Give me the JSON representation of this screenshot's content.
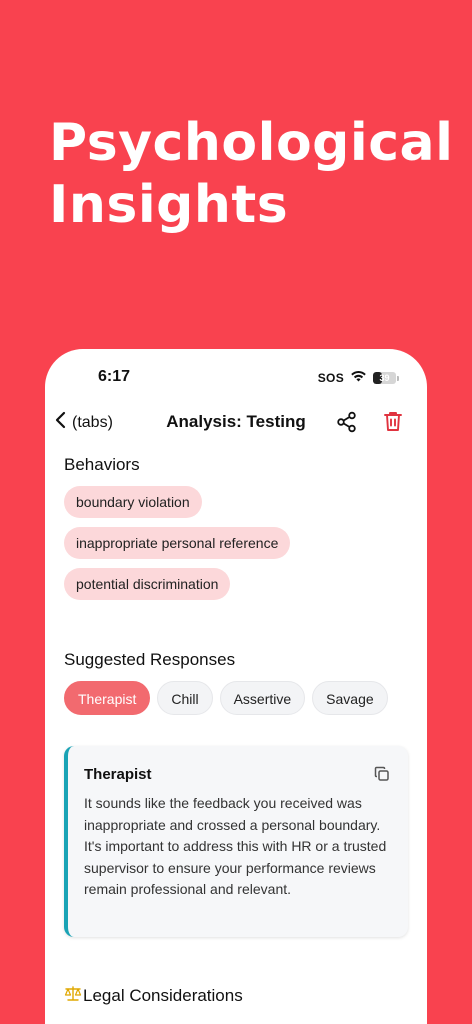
{
  "headline": {
    "line1": "Psychological",
    "line2": "Insights"
  },
  "status_bar": {
    "time": "6:17",
    "sos": "SOS",
    "battery": "39",
    "battery_level": 0.39
  },
  "nav": {
    "back_label": "(tabs)",
    "title": "Analysis: Testing"
  },
  "behaviors": {
    "title": "Behaviors",
    "items": [
      "boundary violation",
      "inappropriate personal reference",
      "potential discrimination"
    ]
  },
  "responses": {
    "title": "Suggested Responses",
    "tabs": [
      "Therapist",
      "Chill",
      "Assertive",
      "Savage"
    ],
    "active_tab": "Therapist",
    "card_title": "Therapist",
    "card_body": "It sounds like the feedback you received was inappropriate and crossed a personal boundary. It's important to address this with HR or a trusted supervisor to ensure your performance reviews remain professional and relevant."
  },
  "legal": {
    "icon": "scales-icon",
    "title": "Legal Considerations"
  },
  "colors": {
    "background": "#F9424F",
    "chip": "#FCD8DA",
    "active_tab": "#F26A6F",
    "card_accent": "#1AA3B5",
    "trash": "#E0333F"
  }
}
